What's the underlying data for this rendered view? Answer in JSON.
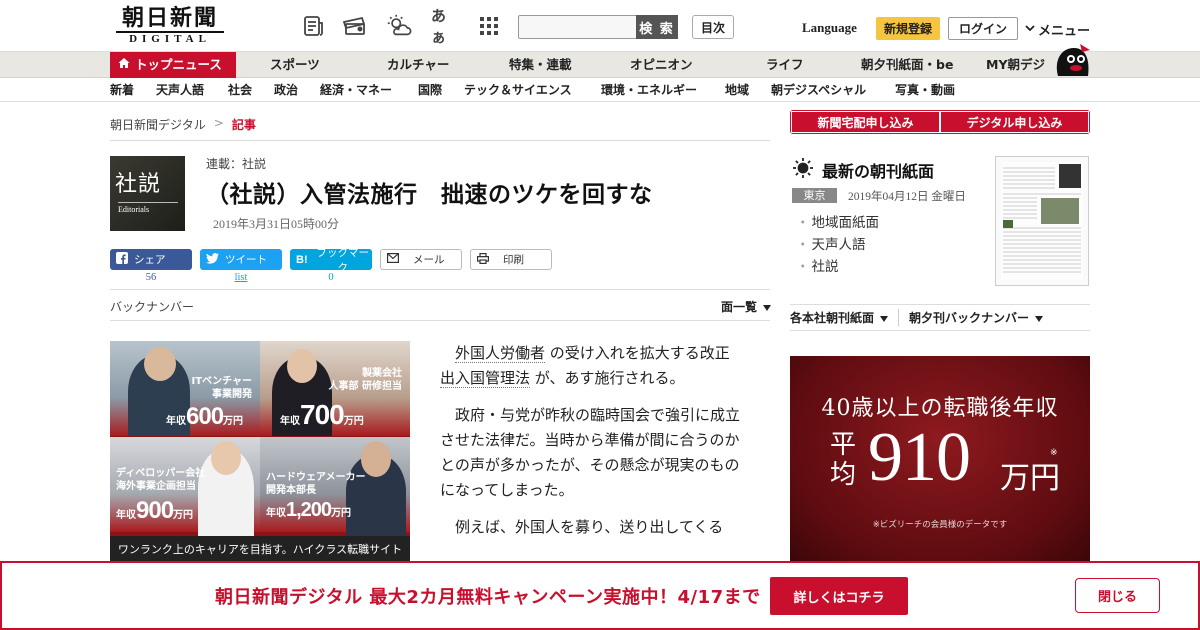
{
  "header": {
    "logo_main": "朝日新聞",
    "logo_sub": "DIGITAL",
    "search_placeholder": "",
    "search_button": "検 索",
    "toc_button": "目次",
    "font_size_label": "あぁ",
    "language": "Language",
    "register": "新規登録",
    "login": "ログイン",
    "menu": "メニュー"
  },
  "nav_primary": [
    "トップニュース",
    "スポーツ",
    "カルチャー",
    "特集・連載",
    "オピニオン",
    "ライフ",
    "朝夕刊紙面・be",
    "MY朝デジ"
  ],
  "nav_secondary": [
    "新着",
    "天声人語",
    "社会",
    "政治",
    "経済・マネー",
    "国際",
    "テック＆サイエンス",
    "環境・エネルギー",
    "地域",
    "朝デジスペシャル",
    "写真・動画"
  ],
  "breadcrumb": {
    "home": "朝日新聞デジタル",
    "sep": ">",
    "current": "記事"
  },
  "article": {
    "thumb_big": "社説",
    "thumb_small": "Editorials",
    "series": "連載：社説",
    "title": "（社説）入管法施行　拙速のツケを回すな",
    "date": "2019年3月31日05時00分",
    "paragraphs": [
      {
        "kw1": "外国人労働者",
        "t1": " の受け入れを拡大する改正 ",
        "kw2": "出入国管理法",
        "t2": " が、あす施行される。"
      },
      {
        "text": "政府・与党が昨秋の臨時国会で強引に成立させた法律だ。当時から準備が間に合うのかとの声が多かったが、その懸念が現実のものになってしまった。"
      },
      {
        "text": "例えば、外国人を募り、送り出してくる"
      }
    ]
  },
  "share": {
    "facebook": {
      "label": "シェア",
      "count": "56"
    },
    "twitter": {
      "label": "ツイート",
      "count": "list"
    },
    "hatena": {
      "label": "ブックマーク",
      "count": "0"
    },
    "mail": {
      "label": "メール"
    },
    "print": {
      "label": "印刷"
    }
  },
  "backnumber": "バックナンバー",
  "list_all": "面一覧",
  "ad_left": {
    "cells": [
      {
        "job": "ITベンチャー\n事業開発",
        "salary_prefix": "年収",
        "salary": "600",
        "unit": "万円"
      },
      {
        "job": "製薬会社\n人事部 研修担当",
        "salary_prefix": "年収",
        "salary": "700",
        "unit": "万円"
      },
      {
        "job": "ディベロッパー会社\n海外事業企画担当",
        "salary_prefix": "年収",
        "salary": "900",
        "unit": "万円"
      },
      {
        "job": "ハードウェアメーカー\n開発本部長",
        "salary_prefix": "年収",
        "salary": "1,200",
        "unit": "万円"
      }
    ],
    "footer": "ワンランク上のキャリアを目指す。ハイクラス転職サイト"
  },
  "right": {
    "sub_home": "新聞宅配申し込み",
    "sub_digital": "デジタル申し込み",
    "morning_title": "最新の朝刊紙面",
    "prefecture": "東京",
    "paper_date": "2019年04月12日 金曜日",
    "links": [
      "地域面紙面",
      "天声人語",
      "社説"
    ],
    "dd1": "各本社朝刊紙面",
    "dd2": "朝夕刊バックナンバー"
  },
  "ad_right": {
    "headline": "40歳以上の転職後年収",
    "avg": "平\n均",
    "number": "910",
    "unit": "万円",
    "mark": "※",
    "note": "※ビズリーチの会員様のデータです"
  },
  "banner": {
    "text": "朝日新聞デジタル 最大2カ月無料キャンペーン実施中！4/17まで",
    "detail": "詳しくはコチラ",
    "close": "閉じる"
  },
  "colors": {
    "brand_red": "#c8102e",
    "register_yellow": "#f6c540",
    "facebook": "#3b5998",
    "twitter": "#1da1f2",
    "hatena": "#00a4de"
  }
}
